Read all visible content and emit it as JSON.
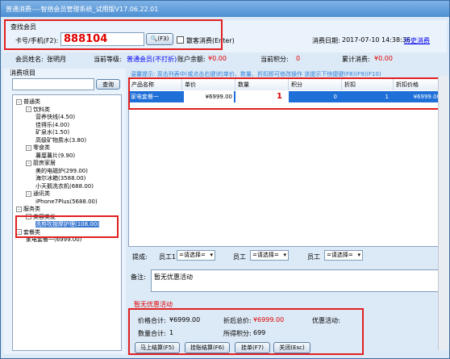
{
  "window": {
    "title": "普通消费----智络会员管理系统_试用版V17.06.22.01"
  },
  "search": {
    "legend": "查找会员",
    "card_label": "卡号/手机(F2):",
    "card_value": "888104",
    "search_btn": "(F3)",
    "nocount_label": "散客消费(Enter)",
    "date_label": "消费日期:",
    "date_value": "2017-07-10 14:38:36",
    "history_link": "历史消费"
  },
  "member": {
    "name_label": "会员姓名:",
    "name": "张明月",
    "level_label": "当前等级:",
    "level": "普通会员(不打折)",
    "balance_label": "账户余额:",
    "balance": "¥0.00",
    "points_label": "当前积分:",
    "points": "0",
    "total_label": "累计消费:",
    "total": "¥0.00"
  },
  "items": {
    "legend": "消费项目",
    "query_btn": "查询",
    "tree": [
      {
        "label": "普通类",
        "level": 0,
        "toggle": "-"
      },
      {
        "label": "饮料类",
        "level": 1,
        "toggle": "-"
      },
      {
        "label": "营养快线(4.50)",
        "level": 2
      },
      {
        "label": "佳得乐(4.00)",
        "level": 2
      },
      {
        "label": "矿泉水(1.50)",
        "level": 2
      },
      {
        "label": "高级矿物质水(3.80)",
        "level": 2
      },
      {
        "label": "零食类",
        "level": 1,
        "toggle": "-"
      },
      {
        "label": "薯厘薯片(9.90)",
        "level": 2
      },
      {
        "label": "厨房家居",
        "level": 1,
        "toggle": "-"
      },
      {
        "label": "美的电磁炉(299.00)",
        "level": 2
      },
      {
        "label": "海尔冰箱(3588.00)",
        "level": 2
      },
      {
        "label": "小天鹅洗衣机(688.00)",
        "level": 2
      },
      {
        "label": "通讯类",
        "level": 1,
        "toggle": "-"
      },
      {
        "label": "iPhone7Plus(5688.00)",
        "level": 2
      },
      {
        "label": "服务类",
        "level": 0,
        "toggle": "-"
      },
      {
        "label": "美容美发",
        "level": 1,
        "toggle": "-"
      },
      {
        "label": "洗剪吹按摩护理(108.00)",
        "level": 2,
        "selected": true
      },
      {
        "label": "套餐类",
        "level": 0,
        "toggle": "-"
      },
      {
        "label": "家电套餐一(6999.00)",
        "level": 1
      }
    ]
  },
  "hint": "温馨提示: 双击列表中(或点击右键)的单价、数量、折扣即可修改操作   该提示下快捷键(F8)(F9)(F10)",
  "table": {
    "columns": [
      "产品名称",
      "单价",
      "数量",
      "积分",
      "折扣",
      "折扣价格"
    ],
    "rows": [
      {
        "name": "家电套餐一",
        "price": "¥6999.00",
        "qty": "1",
        "points": "0",
        "discount": "1",
        "final": "¥6999.00"
      }
    ]
  },
  "staff": {
    "label": "提成:",
    "emp1_label": "员工1",
    "emp_label": "员工",
    "placeholder": "=请选择="
  },
  "remark": {
    "label": "备注:",
    "value": "暂无优惠活动"
  },
  "promo": "暂无优惠活动",
  "summary": {
    "price_total_label": "价格合计:",
    "price_total": "¥6999.00",
    "discount_total_label": "折后总价:",
    "discount_total": "¥6999.00",
    "promo_label": "优惠活动:",
    "qty_total_label": "数量合计:",
    "qty_total": "1",
    "points_label": "所得积分:",
    "points": "699"
  },
  "actions": {
    "checkout": "马上结算(F5)",
    "hang_checkout": "挂账结算(F6)",
    "hang": "挂单(F7)",
    "close": "关闭(Esc)"
  }
}
